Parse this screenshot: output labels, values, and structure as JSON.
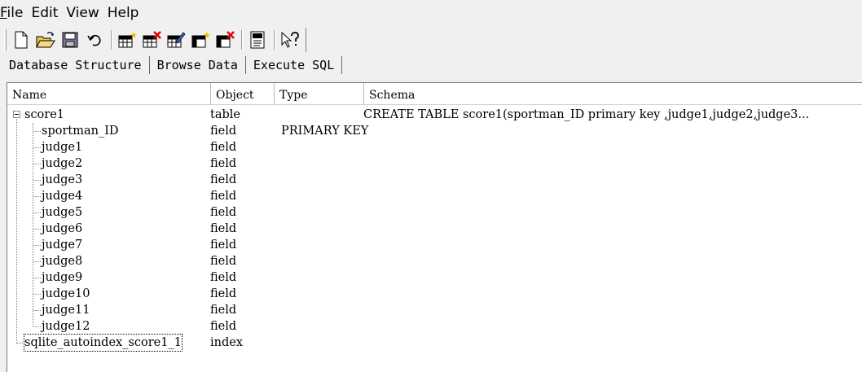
{
  "menu": [
    "File",
    "Edit",
    "View",
    "Help"
  ],
  "toolbar": {
    "buttons": [
      "new-database-icon",
      "open-database-icon",
      "save-icon",
      "undo-icon",
      "create-table-icon",
      "delete-table-icon",
      "modify-table-icon",
      "create-index-icon",
      "delete-index-icon",
      "sql-log-icon",
      "whats-this-help-icon"
    ]
  },
  "tabs": [
    "Database Structure",
    "Browse Data",
    "Execute SQL"
  ],
  "columns": [
    "Name",
    "Object",
    "Type",
    "Schema"
  ],
  "table": {
    "name": "score1",
    "object": "table",
    "type": "",
    "schema": "CREATE TABLE score1(sportman_ID primary key ,judge1,judge2,judge3..."
  },
  "fields": [
    {
      "name": "sportman_ID",
      "object": "field",
      "type": "PRIMARY KEY"
    },
    {
      "name": "judge1",
      "object": "field",
      "type": ""
    },
    {
      "name": "judge2",
      "object": "field",
      "type": ""
    },
    {
      "name": "judge3",
      "object": "field",
      "type": ""
    },
    {
      "name": "judge4",
      "object": "field",
      "type": ""
    },
    {
      "name": "judge5",
      "object": "field",
      "type": ""
    },
    {
      "name": "judge6",
      "object": "field",
      "type": ""
    },
    {
      "name": "judge7",
      "object": "field",
      "type": ""
    },
    {
      "name": "judge8",
      "object": "field",
      "type": ""
    },
    {
      "name": "judge9",
      "object": "field",
      "type": ""
    },
    {
      "name": "judge10",
      "object": "field",
      "type": ""
    },
    {
      "name": "judge11",
      "object": "field",
      "type": ""
    },
    {
      "name": "judge12",
      "object": "field",
      "type": ""
    }
  ],
  "index": {
    "name": "sqlite_autoindex_score1_1",
    "object": "index"
  }
}
